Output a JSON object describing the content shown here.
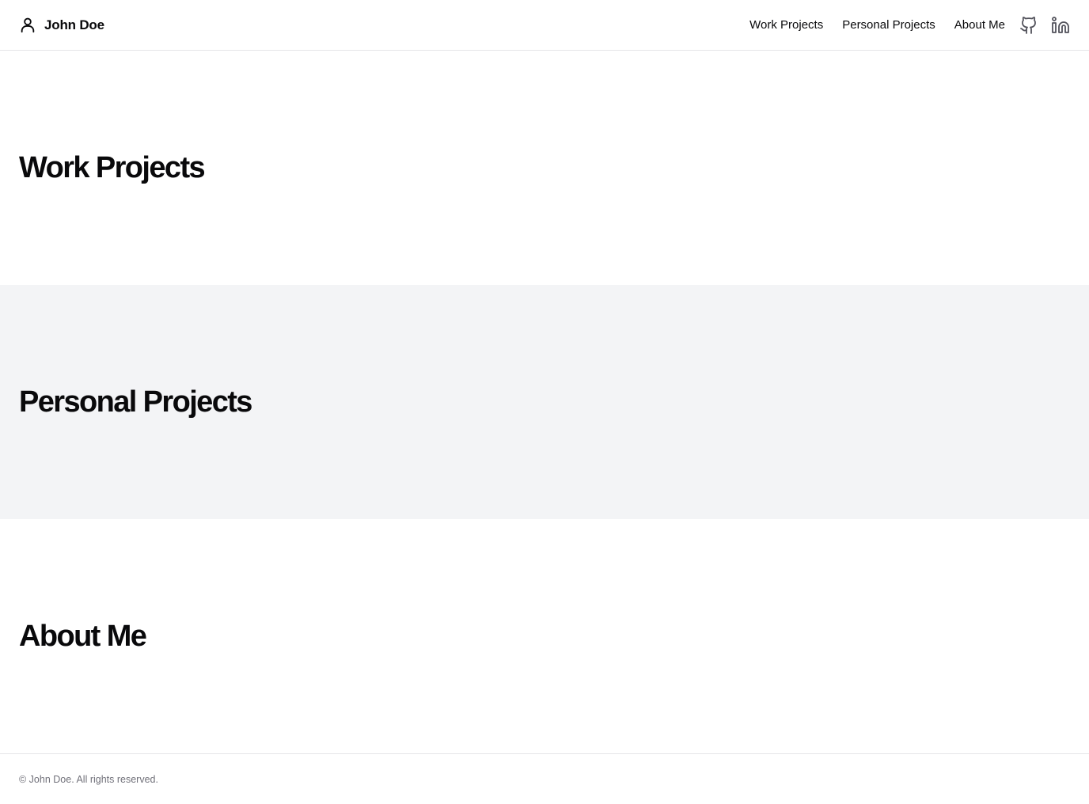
{
  "header": {
    "brand": {
      "icon": "user-icon",
      "name": "John Doe"
    },
    "nav": [
      {
        "label": "Work Projects"
      },
      {
        "label": "Personal Projects"
      },
      {
        "label": "About Me"
      }
    ],
    "social": [
      {
        "icon": "github-icon"
      },
      {
        "icon": "linkedin-icon"
      }
    ]
  },
  "sections": [
    {
      "title": "Work Projects"
    },
    {
      "title": "Personal Projects"
    },
    {
      "title": "About Me"
    }
  ],
  "footer": {
    "text": "© John Doe. All rights reserved."
  },
  "colors": {
    "text": "#09090b",
    "muted": "#71717a",
    "alt_section_bg": "#f3f4f6",
    "border": "#e4e4e7",
    "icon": "#52525b"
  }
}
